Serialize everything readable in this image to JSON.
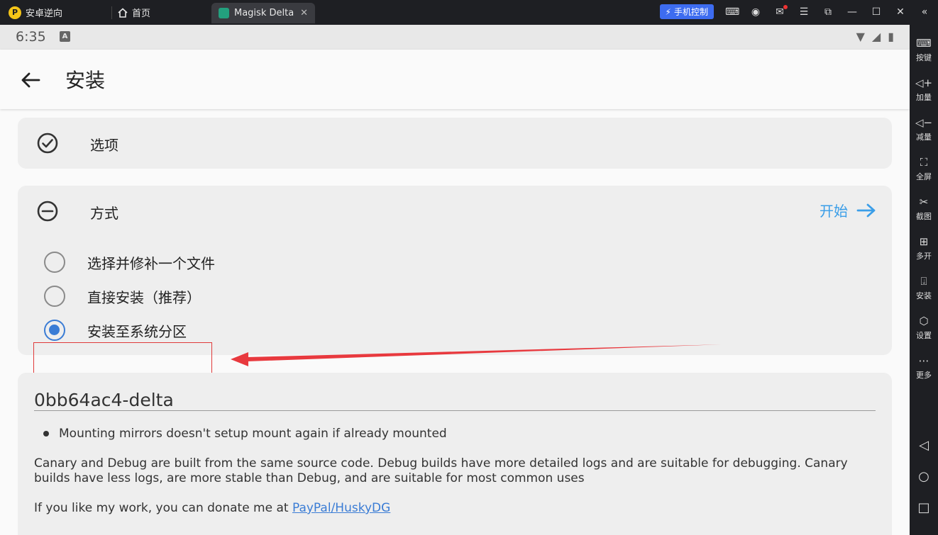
{
  "emulator": {
    "app_name": "安卓逆向",
    "home_tab": "首页",
    "active_tab": "Magisk Delta",
    "phone_control": "手机控制"
  },
  "sidebar": {
    "items": [
      {
        "label": "按键",
        "icon": "keyboard-icon"
      },
      {
        "label": "加量",
        "icon": "volume-up-icon"
      },
      {
        "label": "减量",
        "icon": "volume-down-icon"
      },
      {
        "label": "全屏",
        "icon": "fullscreen-icon"
      },
      {
        "label": "截图",
        "icon": "scissors-icon"
      },
      {
        "label": "多开",
        "icon": "multi-instance-icon"
      },
      {
        "label": "安装",
        "icon": "apk-install-icon"
      },
      {
        "label": "设置",
        "icon": "settings-icon"
      },
      {
        "label": "更多",
        "icon": "more-icon"
      }
    ]
  },
  "android": {
    "time": "6:35",
    "status_badge": "A"
  },
  "appbar": {
    "title": "安装"
  },
  "options_card": {
    "label": "选项"
  },
  "method_card": {
    "label": "方式",
    "start_label": "开始",
    "options": [
      {
        "label": "选择并修补一个文件",
        "checked": false
      },
      {
        "label": "直接安装（推荐）",
        "checked": false
      },
      {
        "label": "安装至系统分区",
        "checked": true
      }
    ]
  },
  "log_card": {
    "title": "0bb64ac4-delta",
    "bullet": "Mounting mirrors doesn't setup mount again if already mounted",
    "paragraph1": "Canary and Debug are built from the same source code.  Debug builds have more detailed logs and are suitable for debugging. Canary builds have less logs, are more stable than Debug, and are suitable for most common uses",
    "paragraph2_prefix": "If you like my work, you can donate me at ",
    "paragraph2_link": "PayPal/HuskyDG"
  },
  "colors": {
    "accent_blue": "#3a7cd5",
    "start_blue": "#3b9ee8",
    "annotation_red": "#e03a3a"
  }
}
